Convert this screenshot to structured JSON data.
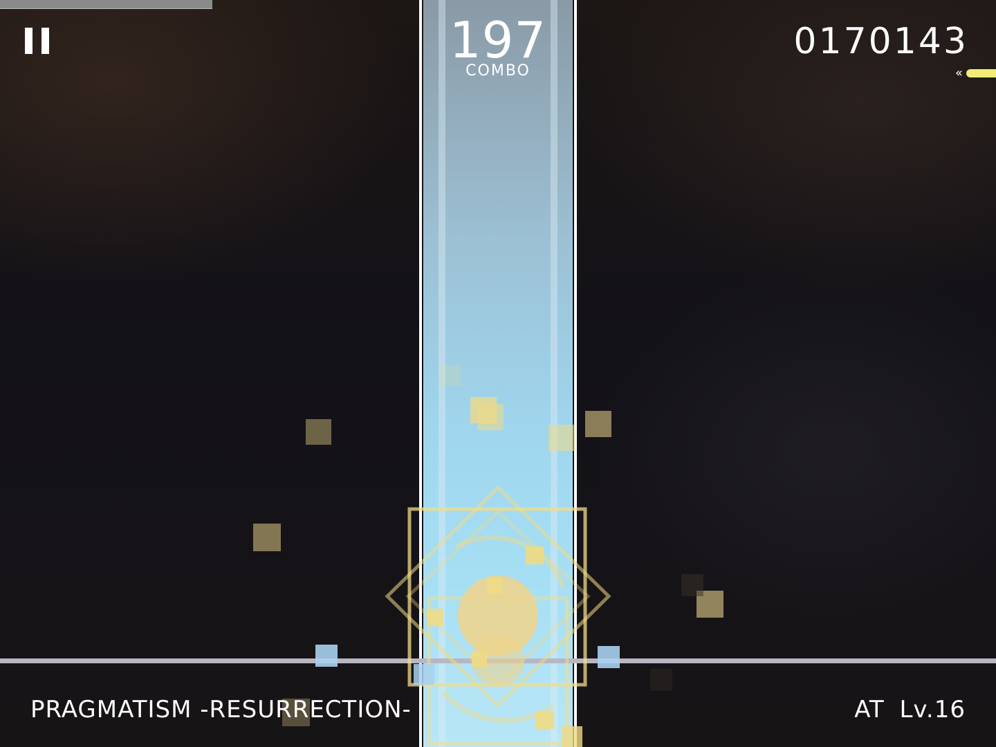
{
  "hud": {
    "combo_count": "197",
    "combo_label": "COMBO",
    "score": "0170143",
    "song_title": "PRAGMATISM -RESURRECTION-",
    "difficulty": "AT  Lv.16",
    "song_progress": 0.213,
    "score_gauge": 0.03
  },
  "icons": {
    "pause": "pause-icon",
    "gauge_arrow": "double-chevron-left-icon"
  },
  "colors": {
    "lane_light": "#a6dff4",
    "lane_dark": "#8a9aa6",
    "hit_gold": "#f0da84",
    "particle_tan": "#a89968",
    "particle_blue": "#a8d0f0",
    "gauge_yellow": "#f2ec78",
    "judgement_line": "#b8b6c2"
  }
}
